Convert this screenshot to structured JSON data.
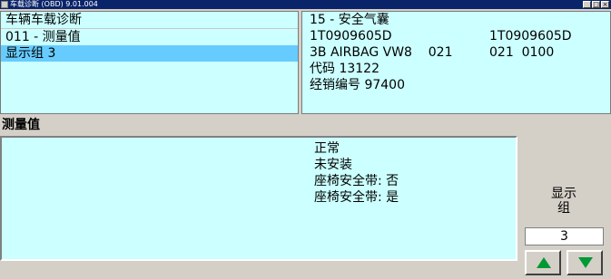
{
  "window": {
    "title": "车载诊断 (OBD)  9.01.004",
    "controls": [
      "_",
      "□",
      "×"
    ]
  },
  "left_panel": {
    "line1": "车辆车载诊断",
    "line2": "011 - 测量值",
    "line3": "显示组 3"
  },
  "right_panel": {
    "line1": "15 - 安全气囊",
    "line2_a": "1T0909605D",
    "line2_b": "1T0909605D",
    "line3_a": "3B AIRBAG VW8    021",
    "line3_b": "021  0100",
    "line4": "代码 13122",
    "line5": "经销编号 97400"
  },
  "measurements": {
    "label": "测量值",
    "values": [
      "正常",
      "未安装",
      "座椅安全带: 否",
      "座椅安全带: 是"
    ]
  },
  "display_group": {
    "label": "显示组",
    "value": "3"
  },
  "colors": {
    "panel_bg": "#ccffff",
    "selected_row": "#66ccff",
    "titlebar": "#0a246a",
    "arrow_green": "#009933"
  },
  "icons": {
    "up": "up-arrow-icon",
    "down": "down-arrow-icon"
  }
}
